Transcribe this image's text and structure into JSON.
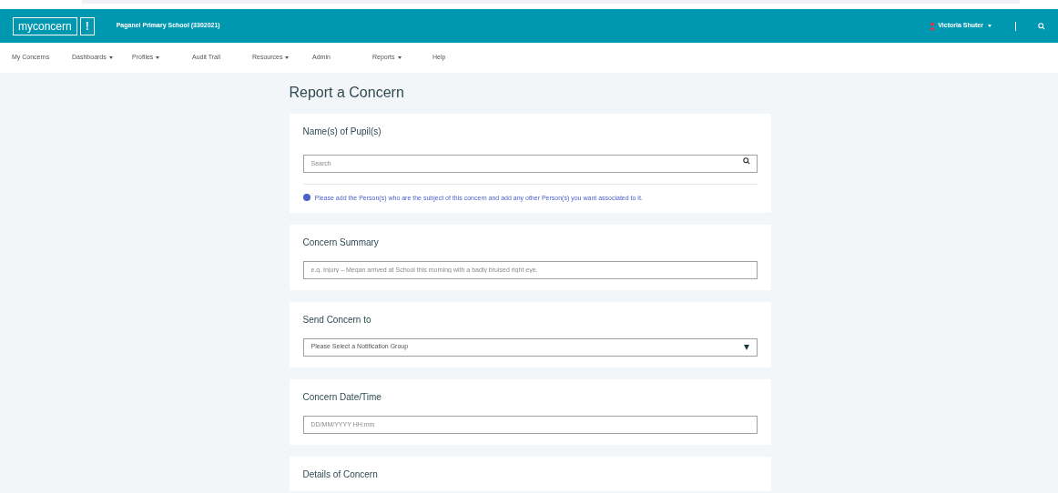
{
  "header": {
    "logo_text": "myconcern",
    "logo_mark": "!",
    "school": "Paganel Primary School (3302021)",
    "user": "Victoria Shuter"
  },
  "nav": [
    {
      "label": "My Concerns",
      "dropdown": false
    },
    {
      "label": "Dashboards",
      "dropdown": true
    },
    {
      "label": "Profiles",
      "dropdown": true
    },
    {
      "label": "Audit Trail",
      "dropdown": false
    },
    {
      "label": "Resources",
      "dropdown": true
    },
    {
      "label": "Admin",
      "dropdown": false
    },
    {
      "label": "Reports",
      "dropdown": true
    },
    {
      "label": "Help",
      "dropdown": false
    }
  ],
  "page_title": "Report a Concern",
  "sections": [
    {
      "kind": "search",
      "title": "Name(s) of Pupil(s)",
      "placeholder": "Search",
      "info": "Please add the Person(s) who are the subject of this concern and add any other Person(s) you want associated to it."
    },
    {
      "kind": "text",
      "title": "Concern Summary",
      "placeholder": "e.g. Injury – Megan arrived at School this morning with a badly bruised right eye."
    },
    {
      "kind": "select",
      "title": "Send Concern to",
      "placeholder": "Please Select a Notification Group"
    },
    {
      "kind": "text",
      "title": "Concern Date/Time",
      "placeholder": "DD/MM/YYYY HH:mm"
    },
    {
      "kind": "heading",
      "title": "Details of Concern"
    }
  ]
}
